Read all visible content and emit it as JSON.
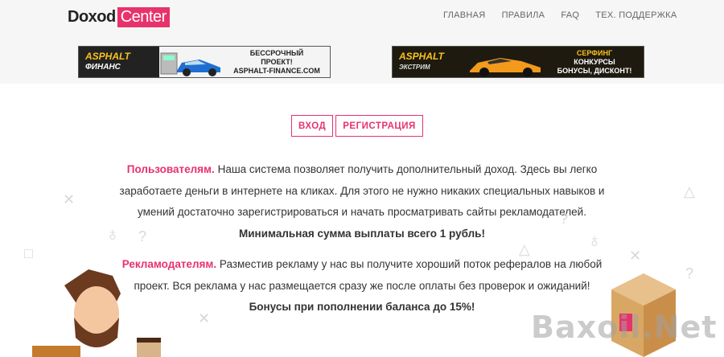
{
  "logo": {
    "part1": "Doxod",
    "part2": "Center"
  },
  "nav": [
    {
      "label": "ГЛАВНАЯ"
    },
    {
      "label": "ПРАВИЛА"
    },
    {
      "label": "FAQ"
    },
    {
      "label": "ТЕХ. ПОДДЕРЖКА"
    }
  ],
  "banners": {
    "left": {
      "logo_top": "ASPHALT",
      "logo_bottom": "ФИНАНС",
      "line1": "БЕССРОЧНЫЙ",
      "line2": "ПРОЕКТ!",
      "line3": "ASPHALT-FINANCE.COM"
    },
    "right": {
      "logo_top": "ASPHALT",
      "logo_bottom": "ЭКСТРИМ",
      "line1": "СЕРФИНГ",
      "line2": "КОНКУРСЫ",
      "line3": "БОНУСЫ, ДИСКОНТ!"
    }
  },
  "auth": {
    "login": "ВХОД",
    "register": "РЕГИСТРАЦИЯ"
  },
  "users": {
    "lead": "Пользователям.",
    "body": " Наша система позволяет получить дополнительный доход. Здесь вы легко заработаете деньги в интернете на кликах. Для этого не нужно никаких специальных навыков и умений достаточно зарегистрироваться и начать просматривать сайты рекламодателей.",
    "emphasis": "Минимальная сумма выплаты всего 1 рубль!"
  },
  "advertisers": {
    "lead": "Рекламодателям.",
    "body": " Разместив рекламу у нас вы получите хороший поток рефералов на любой проект. Вся реклама у нас размещается сразу же после оплаты без проверок и ожиданий!",
    "emphasis": "Бонусы при пополнении баланса до 15%!"
  },
  "watermark": "Baxoil.Net"
}
